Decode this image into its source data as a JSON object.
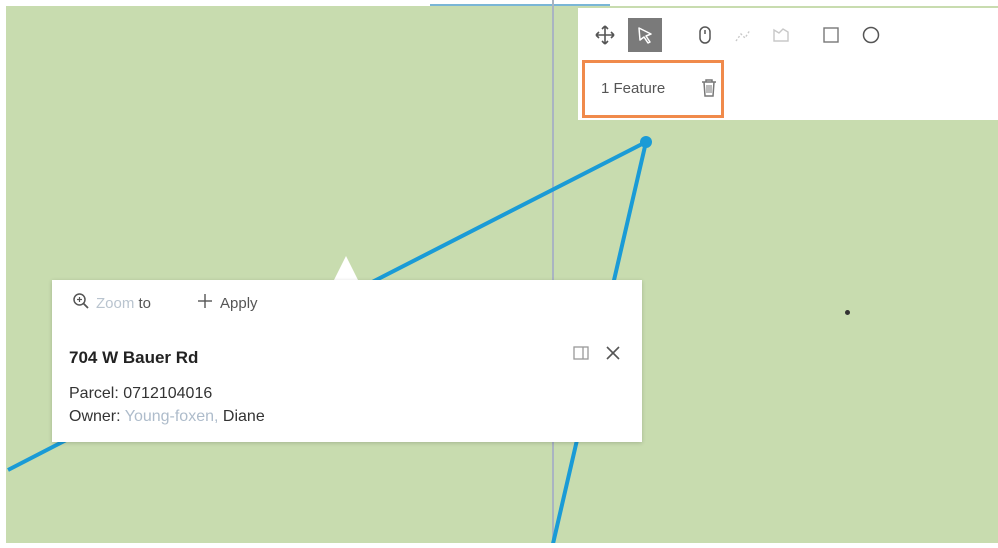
{
  "toolbar": {
    "tools": [
      {
        "icon": "move-icon"
      },
      {
        "icon": "select-arrow-icon",
        "active": true
      },
      {
        "icon": "mouse-icon"
      },
      {
        "icon": "polyline-icon"
      },
      {
        "icon": "polygon-icon"
      },
      {
        "icon": "rectangle-icon"
      },
      {
        "icon": "circle-icon"
      }
    ],
    "feature_label": "1 Feature",
    "feature_box_color": "#f08a4b"
  },
  "popup": {
    "zoom_label_faded": "Zoom",
    "zoom_label": "to",
    "apply_label": "Apply",
    "title": "704 W Bauer Rd",
    "parcel_label": "Parcel:",
    "parcel_value": "0712104016",
    "owner_label": "Owner:",
    "owner_value_faded": "Young-foxen,",
    "owner_value": "Diane"
  },
  "colors": {
    "map_fill": "#c8dcaf",
    "sketch_line": "#1a9bd6",
    "active_tool": "#7a7a7a"
  }
}
